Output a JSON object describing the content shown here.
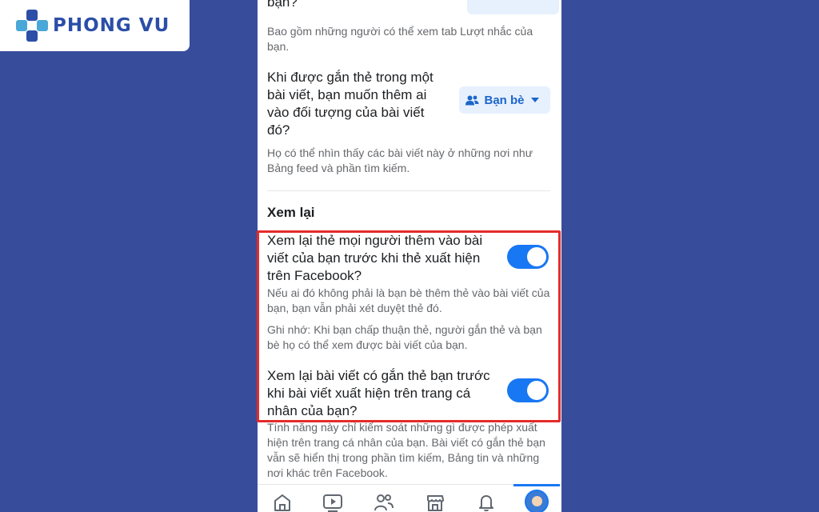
{
  "brand": {
    "name": "PHONG VU"
  },
  "settings": {
    "top_question": "bạn?",
    "top_description": "Bao gồm những người có thể xem tab Lượt nhắc của bạn.",
    "tag_question": "Khi được gắn thẻ trong một bài viết, bạn muốn thêm ai vào đối tượng của bài viết đó?",
    "tag_audience_value": "Bạn bè",
    "tag_description": "Họ có thể nhìn thấy các bài viết này ở những nơi như Bảng feed và phần tìm kiếm.",
    "review_section_title": "Xem lại",
    "review_tags_question": "Xem lại thẻ mọi người thêm vào bài viết của bạn trước khi thẻ xuất hiện trên Facebook?",
    "review_tags_desc_1": "Nếu ai đó không phải là bạn bè thêm thẻ vào bài viết của bạn, bạn vẫn phải xét duyệt thẻ đó.",
    "review_tags_desc_2": "Ghi nhớ: Khi bạn chấp thuận thẻ, người gắn thẻ và bạn bè họ có thể xem được bài viết của bạn.",
    "review_tags_enabled": true,
    "review_posts_question": "Xem lại bài viết có gắn thẻ bạn trước khi bài viết xuất hiện trên trang cá nhân của bạn?",
    "review_posts_enabled": true,
    "review_posts_desc": "Tính năng này chỉ kiểm soát những gì được phép xuất hiện trên trang cá nhân của bạn. Bài viết có gắn thẻ bạn vẫn sẽ hiển thị trong phần tìm kiếm, Bảng tin và những nơi khác trên Facebook."
  },
  "colors": {
    "background": "#374d9c",
    "brand": "#2b4ea7",
    "accent": "#1877f2",
    "highlight": "#e52b2b"
  },
  "nav": {
    "items": [
      "home-icon",
      "video-icon",
      "friends-icon",
      "marketplace-icon",
      "bell-icon",
      "profile-avatar"
    ],
    "active": "profile-avatar"
  }
}
